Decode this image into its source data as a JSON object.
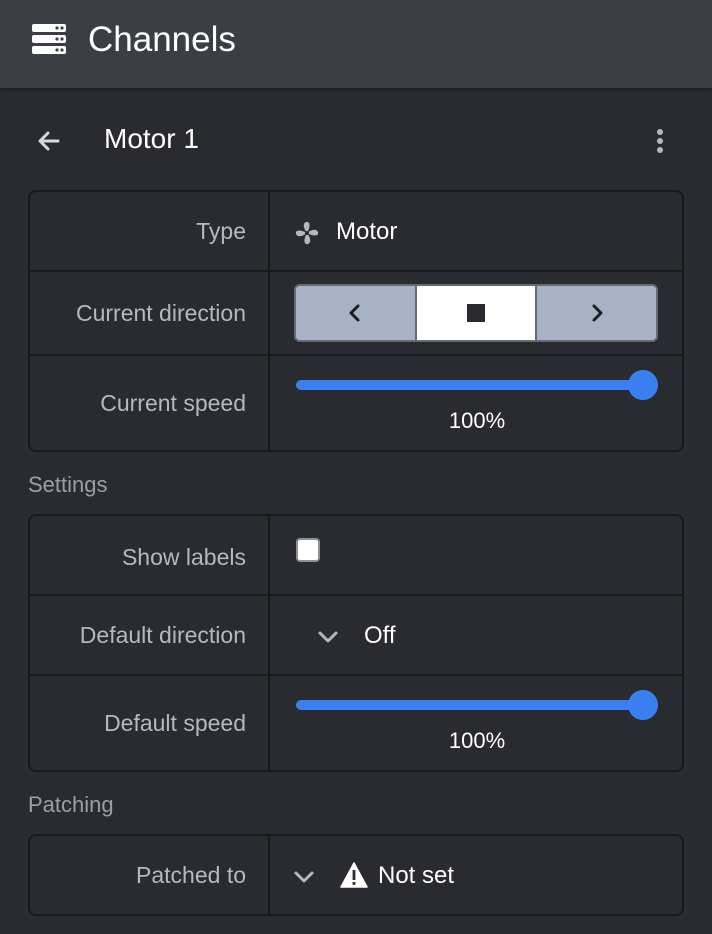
{
  "header": {
    "title": "Channels",
    "icon": "server-stack-icon"
  },
  "channel": {
    "name": "Motor 1",
    "back_icon": "arrow-left-icon",
    "menu_icon": "kebab-menu-icon"
  },
  "info": {
    "type_label": "Type",
    "type_value": "Motor",
    "type_icon": "fan-icon",
    "direction_label": "Current direction",
    "direction_options": [
      "reverse",
      "stop",
      "forward"
    ],
    "direction_selected": "stop",
    "speed_label": "Current speed",
    "speed_value": "100%",
    "speed_fraction": 1.0
  },
  "settings": {
    "title": "Settings",
    "show_labels_label": "Show labels",
    "show_labels_checked": false,
    "default_direction_label": "Default direction",
    "default_direction_value": "Off",
    "default_speed_label": "Default speed",
    "default_speed_value": "100%",
    "default_speed_fraction": 1.0
  },
  "patching": {
    "title": "Patching",
    "patched_to_label": "Patched to",
    "patched_to_value": "Not set",
    "warning_icon": "warning-icon"
  },
  "colors": {
    "background": "#2a2b31",
    "header": "#3b3e45",
    "accent": "#3a7ff0",
    "label": "#b4b8c0",
    "border": "#17181c"
  }
}
